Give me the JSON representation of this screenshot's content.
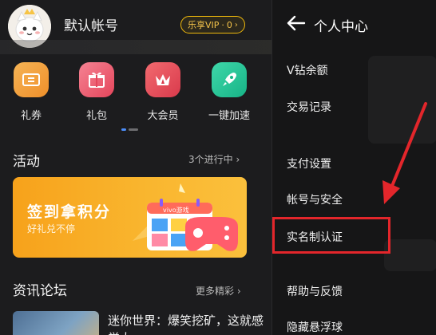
{
  "header": {
    "username": "默认帐号",
    "vip_label": "乐享VIP",
    "vip_sep": "·",
    "vip_level": "0",
    "vip_chevron": "›"
  },
  "quick_actions": [
    {
      "label": "礼券",
      "icon": "ticket-icon",
      "color": "#f2a03a"
    },
    {
      "label": "礼包",
      "icon": "gift-icon",
      "color": "#ee5a6f"
    },
    {
      "label": "大会员",
      "icon": "crown-icon",
      "color": "#ea4f5a"
    },
    {
      "label": "一键加速",
      "icon": "rocket-icon",
      "color": "#27c79a"
    }
  ],
  "activity": {
    "title": "活动",
    "more": "3个进行中 ›",
    "banner_title": "签到拿积分",
    "banner_subtitle": "好礼兑不停",
    "banner_brand": "vivo游戏"
  },
  "forum": {
    "title": "资讯论坛",
    "more": "更多精彩 ›",
    "news_title": "迷你世界：爆笑挖矿，这就感觉太"
  },
  "right_panel": {
    "title": "个人中心",
    "back_icon": "back-arrow-icon",
    "items": [
      "V钻余额",
      "交易记录",
      "支付设置",
      "帐号与安全",
      "实名制认证",
      "帮助与反馈",
      "隐藏悬浮球"
    ]
  },
  "colors": {
    "accent_gold": "#f0b90b",
    "highlight_red": "#e3262b",
    "banner_orange": "#f7a21b"
  }
}
